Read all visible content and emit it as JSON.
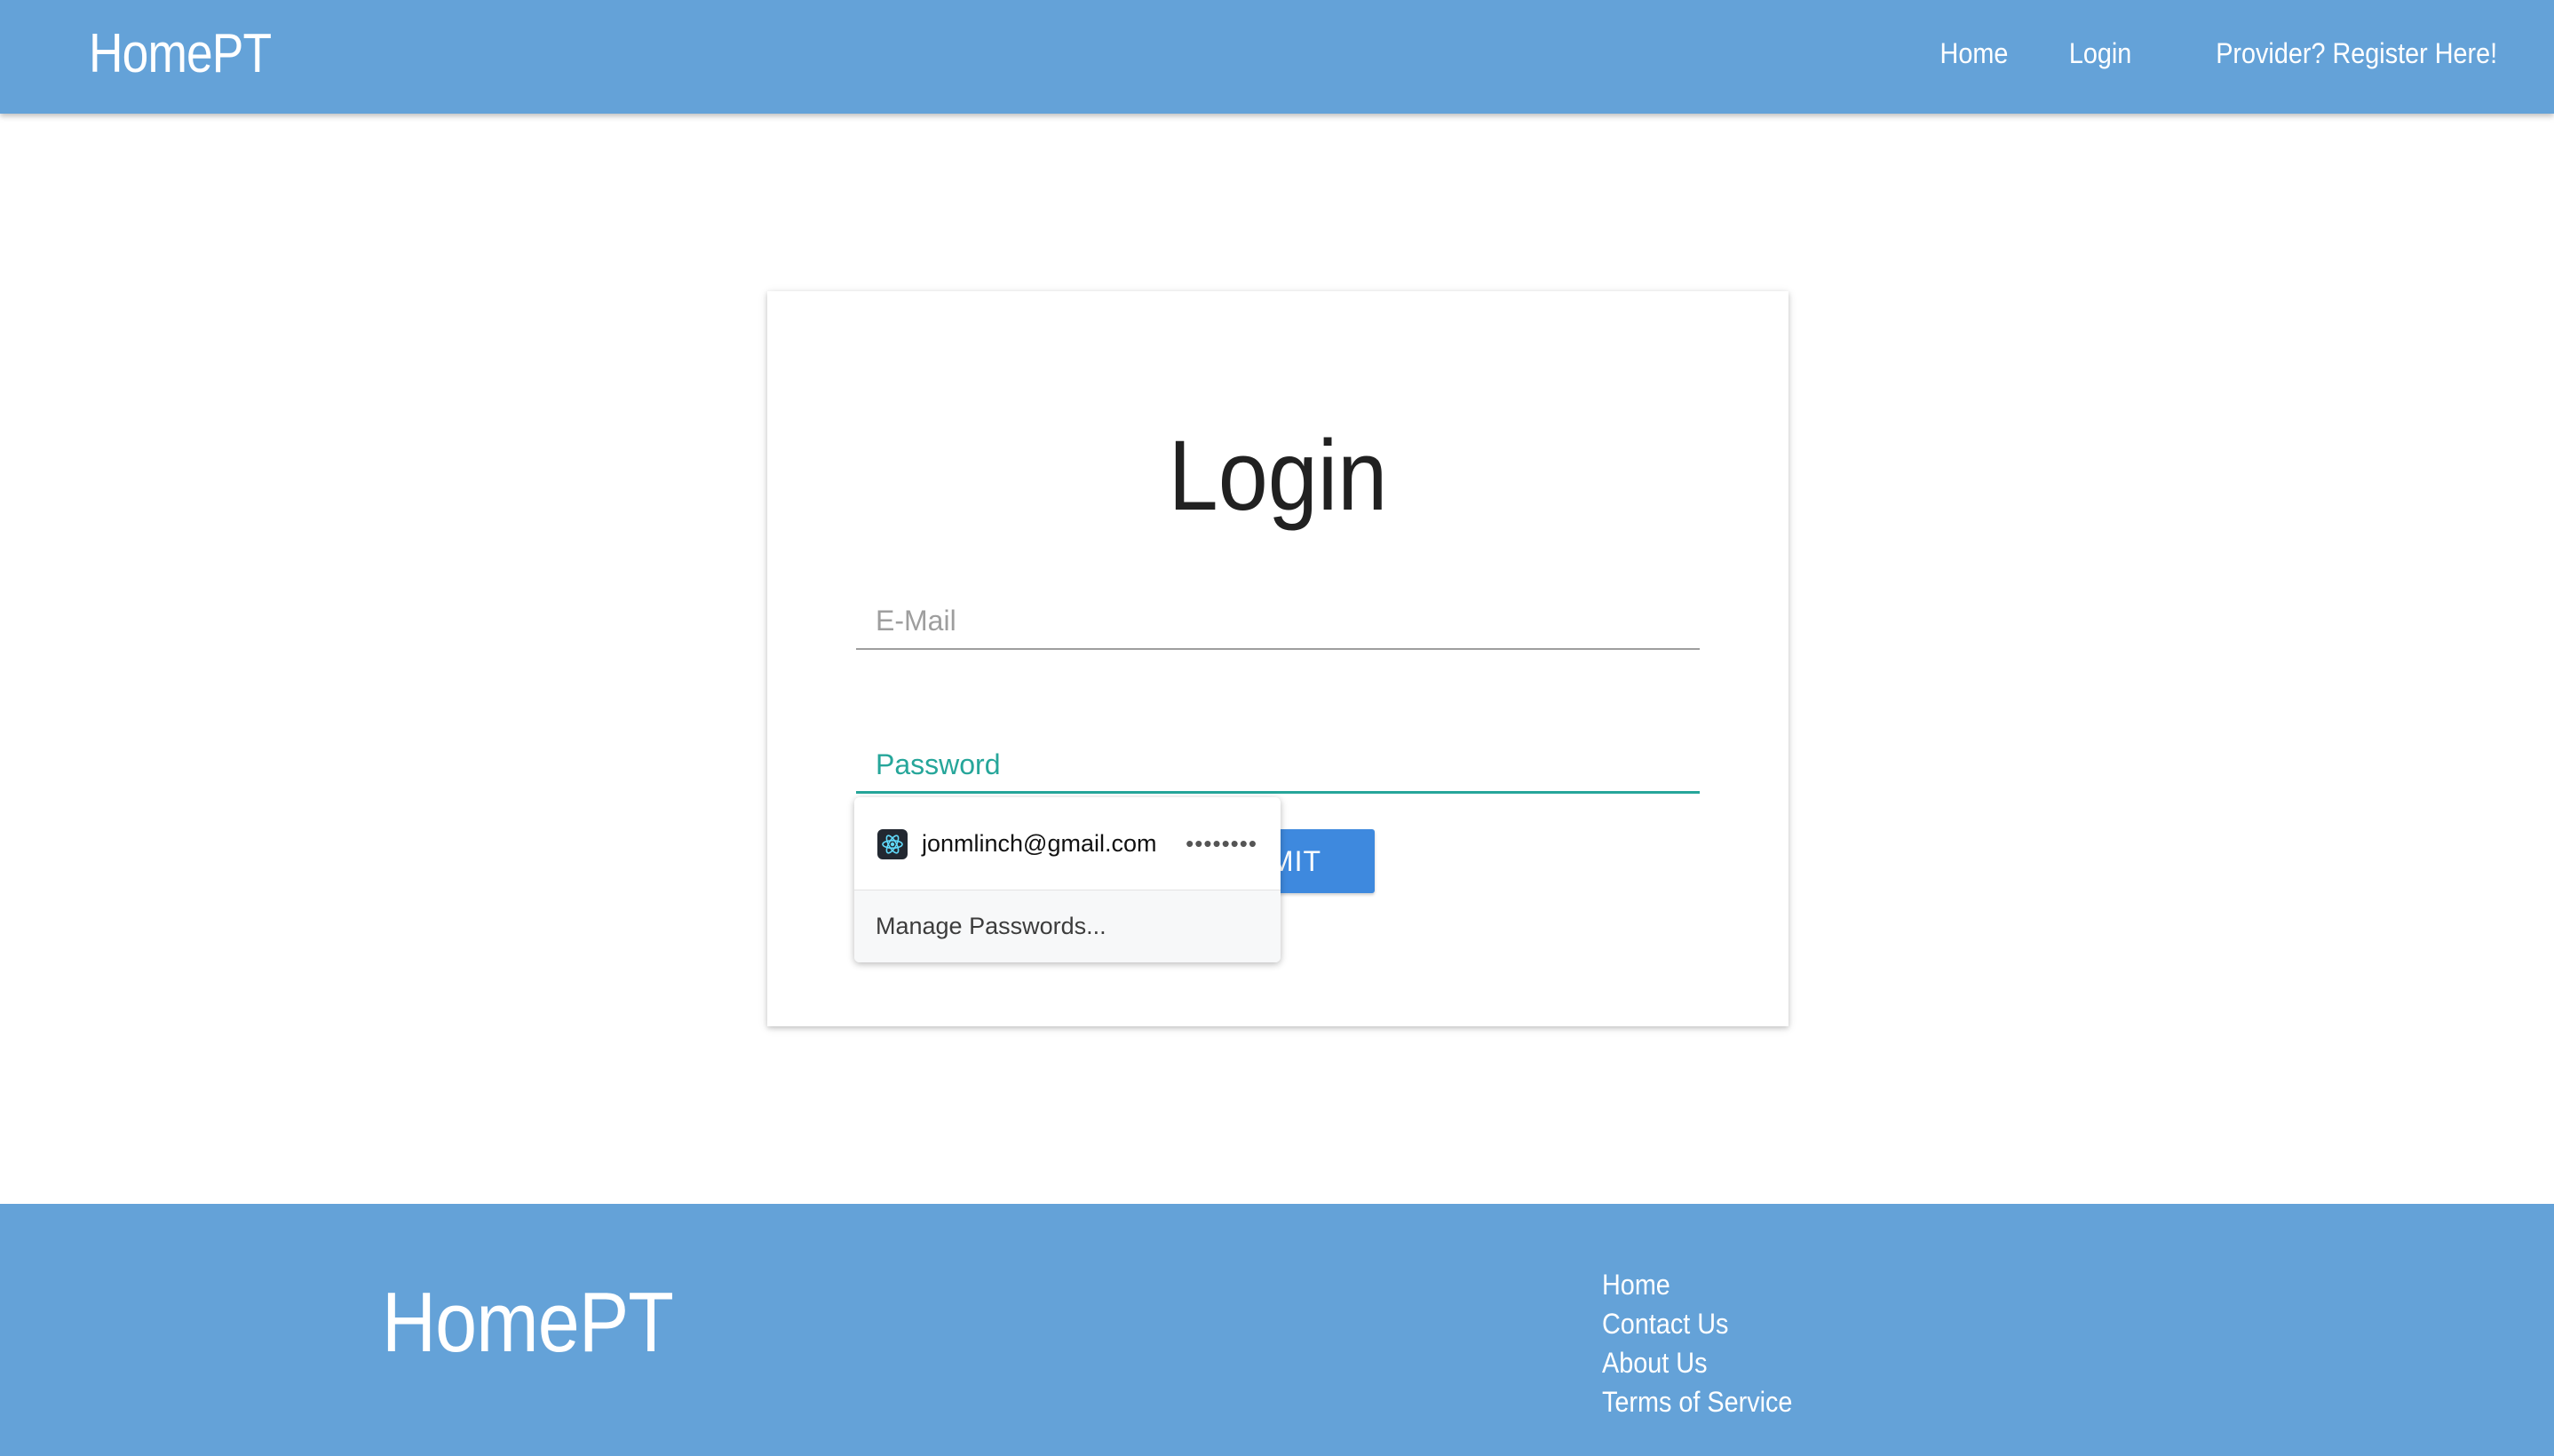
{
  "navbar": {
    "brand": "HomePT",
    "links": [
      "Home",
      "Login",
      "Provider? Register Here!"
    ]
  },
  "login_card": {
    "title": "Login",
    "email_placeholder": "E-Mail",
    "password_placeholder": "Password",
    "submit_label": "MIT"
  },
  "autofill": {
    "saved_email": "jonmlinch@gmail.com",
    "saved_password_mask": "••••••••",
    "manage_label": "Manage Passwords..."
  },
  "footer": {
    "brand": "HomePT",
    "links": [
      "Home",
      "Contact Us",
      "About Us",
      "Terms of Service"
    ]
  },
  "colors": {
    "header_footer_bg": "#64a2d8",
    "accent_teal": "#26a69a",
    "submit_blue": "#3e89de"
  }
}
